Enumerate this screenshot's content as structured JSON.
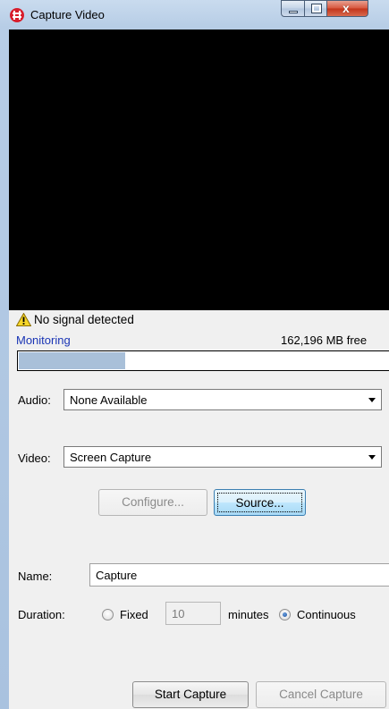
{
  "window": {
    "title": "Capture Video",
    "controls": {
      "close_glyph": "x"
    }
  },
  "status": {
    "warning_icon": "warning-icon",
    "signal_text": "No signal detected",
    "monitoring_label": "Monitoring",
    "free_space": "162,196 MB free",
    "meter_level": 0.28
  },
  "audio": {
    "label": "Audio:",
    "selected": "None Available"
  },
  "video": {
    "label": "Video:",
    "selected": "Screen Capture"
  },
  "buttons": {
    "configure": "Configure...",
    "source": "Source...",
    "start": "Start Capture",
    "cancel": "Cancel Capture"
  },
  "name": {
    "label": "Name:",
    "value": "Capture"
  },
  "duration": {
    "label": "Duration:",
    "fixed_label": "Fixed",
    "fixed_value": "10",
    "unit": "minutes",
    "continuous_label": "Continuous",
    "selected": "Continuous"
  },
  "colors": {
    "monitoring_link": "#1a35b5",
    "meter_fill": "#a9c0d9",
    "video_bg": "#000000"
  }
}
